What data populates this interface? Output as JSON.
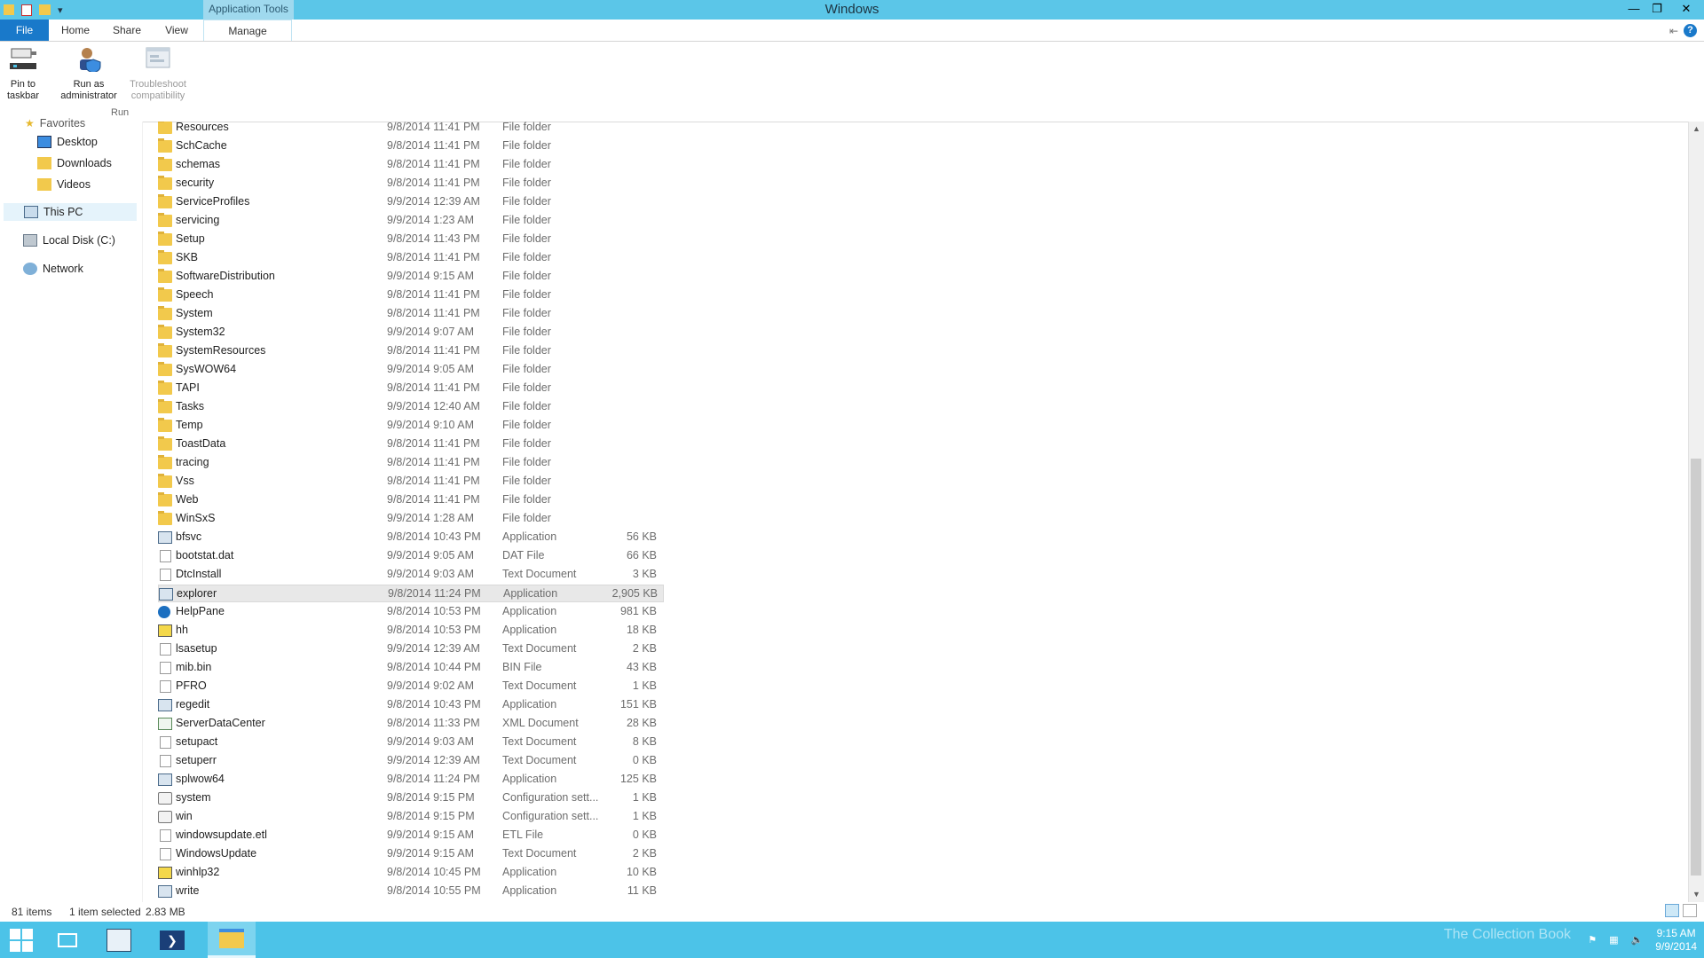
{
  "window": {
    "title": "Windows",
    "contextual_tab_group": "Application Tools",
    "controls": {
      "minimize": "—",
      "restore": "❐",
      "close": "✕"
    }
  },
  "ribbon": {
    "tabs": [
      "File",
      "Home",
      "Share",
      "View",
      "Manage"
    ],
    "buttons": {
      "pin_to_taskbar": "Pin to\ntaskbar",
      "run_as_admin": "Run as\nadministrator",
      "troubleshoot": "Troubleshoot\ncompatibility"
    },
    "group_label": "Run",
    "help": "?"
  },
  "nav": {
    "favorites_partial": "Favorites",
    "desktop": "Desktop",
    "downloads": "Downloads",
    "videos": "Videos",
    "this_pc": "This PC",
    "local_disk": "Local Disk (C:)",
    "network": "Network"
  },
  "files": [
    {
      "name": "Resources",
      "date": "9/8/2014 11:41 PM",
      "type": "File folder",
      "size": "",
      "icon": "folder"
    },
    {
      "name": "SchCache",
      "date": "9/8/2014 11:41 PM",
      "type": "File folder",
      "size": "",
      "icon": "folder"
    },
    {
      "name": "schemas",
      "date": "9/8/2014 11:41 PM",
      "type": "File folder",
      "size": "",
      "icon": "folder"
    },
    {
      "name": "security",
      "date": "9/8/2014 11:41 PM",
      "type": "File folder",
      "size": "",
      "icon": "folder"
    },
    {
      "name": "ServiceProfiles",
      "date": "9/9/2014 12:39 AM",
      "type": "File folder",
      "size": "",
      "icon": "folder"
    },
    {
      "name": "servicing",
      "date": "9/9/2014 1:23 AM",
      "type": "File folder",
      "size": "",
      "icon": "folder"
    },
    {
      "name": "Setup",
      "date": "9/8/2014 11:43 PM",
      "type": "File folder",
      "size": "",
      "icon": "folder"
    },
    {
      "name": "SKB",
      "date": "9/8/2014 11:41 PM",
      "type": "File folder",
      "size": "",
      "icon": "folder"
    },
    {
      "name": "SoftwareDistribution",
      "date": "9/9/2014 9:15 AM",
      "type": "File folder",
      "size": "",
      "icon": "folder"
    },
    {
      "name": "Speech",
      "date": "9/8/2014 11:41 PM",
      "type": "File folder",
      "size": "",
      "icon": "folder"
    },
    {
      "name": "System",
      "date": "9/8/2014 11:41 PM",
      "type": "File folder",
      "size": "",
      "icon": "folder"
    },
    {
      "name": "System32",
      "date": "9/9/2014 9:07 AM",
      "type": "File folder",
      "size": "",
      "icon": "folder"
    },
    {
      "name": "SystemResources",
      "date": "9/8/2014 11:41 PM",
      "type": "File folder",
      "size": "",
      "icon": "folder"
    },
    {
      "name": "SysWOW64",
      "date": "9/9/2014 9:05 AM",
      "type": "File folder",
      "size": "",
      "icon": "folder"
    },
    {
      "name": "TAPI",
      "date": "9/8/2014 11:41 PM",
      "type": "File folder",
      "size": "",
      "icon": "folder"
    },
    {
      "name": "Tasks",
      "date": "9/9/2014 12:40 AM",
      "type": "File folder",
      "size": "",
      "icon": "folder"
    },
    {
      "name": "Temp",
      "date": "9/9/2014 9:10 AM",
      "type": "File folder",
      "size": "",
      "icon": "folder"
    },
    {
      "name": "ToastData",
      "date": "9/8/2014 11:41 PM",
      "type": "File folder",
      "size": "",
      "icon": "folder"
    },
    {
      "name": "tracing",
      "date": "9/8/2014 11:41 PM",
      "type": "File folder",
      "size": "",
      "icon": "folder"
    },
    {
      "name": "Vss",
      "date": "9/8/2014 11:41 PM",
      "type": "File folder",
      "size": "",
      "icon": "folder"
    },
    {
      "name": "Web",
      "date": "9/8/2014 11:41 PM",
      "type": "File folder",
      "size": "",
      "icon": "folder"
    },
    {
      "name": "WinSxS",
      "date": "9/9/2014 1:28 AM",
      "type": "File folder",
      "size": "",
      "icon": "folder"
    },
    {
      "name": "bfsvc",
      "date": "9/8/2014 10:43 PM",
      "type": "Application",
      "size": "56 KB",
      "icon": "app"
    },
    {
      "name": "bootstat.dat",
      "date": "9/9/2014 9:05 AM",
      "type": "DAT File",
      "size": "66 KB",
      "icon": "doc"
    },
    {
      "name": "DtcInstall",
      "date": "9/9/2014 9:03 AM",
      "type": "Text Document",
      "size": "3 KB",
      "icon": "doc"
    },
    {
      "name": "explorer",
      "date": "9/8/2014 11:24 PM",
      "type": "Application",
      "size": "2,905 KB",
      "icon": "app",
      "selected": true
    },
    {
      "name": "HelpPane",
      "date": "9/8/2014 10:53 PM",
      "type": "Application",
      "size": "981 KB",
      "icon": "helpico"
    },
    {
      "name": "hh",
      "date": "9/8/2014 10:53 PM",
      "type": "Application",
      "size": "18 KB",
      "icon": "hhico"
    },
    {
      "name": "lsasetup",
      "date": "9/9/2014 12:39 AM",
      "type": "Text Document",
      "size": "2 KB",
      "icon": "doc"
    },
    {
      "name": "mib.bin",
      "date": "9/8/2014 10:44 PM",
      "type": "BIN File",
      "size": "43 KB",
      "icon": "doc"
    },
    {
      "name": "PFRO",
      "date": "9/9/2014 9:02 AM",
      "type": "Text Document",
      "size": "1 KB",
      "icon": "doc"
    },
    {
      "name": "regedit",
      "date": "9/8/2014 10:43 PM",
      "type": "Application",
      "size": "151 KB",
      "icon": "app"
    },
    {
      "name": "ServerDataCenter",
      "date": "9/8/2014 11:33 PM",
      "type": "XML Document",
      "size": "28 KB",
      "icon": "xml"
    },
    {
      "name": "setupact",
      "date": "9/9/2014 9:03 AM",
      "type": "Text Document",
      "size": "8 KB",
      "icon": "doc"
    },
    {
      "name": "setuperr",
      "date": "9/9/2014 12:39 AM",
      "type": "Text Document",
      "size": "0 KB",
      "icon": "doc"
    },
    {
      "name": "splwow64",
      "date": "9/8/2014 11:24 PM",
      "type": "Application",
      "size": "125 KB",
      "icon": "app"
    },
    {
      "name": "system",
      "date": "9/8/2014 9:15 PM",
      "type": "Configuration sett...",
      "size": "1 KB",
      "icon": "cfg"
    },
    {
      "name": "win",
      "date": "9/8/2014 9:15 PM",
      "type": "Configuration sett...",
      "size": "1 KB",
      "icon": "cfg"
    },
    {
      "name": "windowsupdate.etl",
      "date": "9/9/2014 9:15 AM",
      "type": "ETL File",
      "size": "0 KB",
      "icon": "doc"
    },
    {
      "name": "WindowsUpdate",
      "date": "9/9/2014 9:15 AM",
      "type": "Text Document",
      "size": "2 KB",
      "icon": "doc"
    },
    {
      "name": "winhlp32",
      "date": "9/8/2014 10:45 PM",
      "type": "Application",
      "size": "10 KB",
      "icon": "hhico"
    },
    {
      "name": "write",
      "date": "9/8/2014 10:55 PM",
      "type": "Application",
      "size": "11 KB",
      "icon": "app"
    }
  ],
  "status": {
    "items": "81 items",
    "selected": "1 item selected",
    "size": "2.83 MB"
  },
  "taskbar": {
    "clock_time": "9:15 AM",
    "clock_date": "9/9/2014",
    "watermark": "The Collection Book"
  }
}
